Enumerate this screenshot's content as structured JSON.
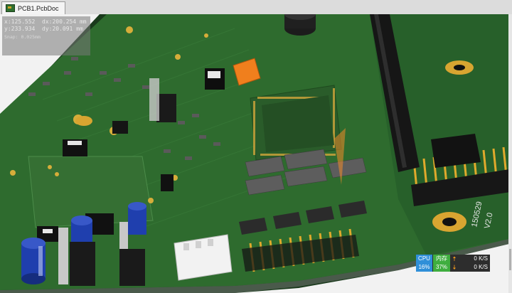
{
  "tab": {
    "title": "PCB1.PcbDoc",
    "icon": "pcb-document-icon"
  },
  "hud": {
    "x": "x:125.552",
    "dx": "dx:200.254 mm",
    "y": "y:233.934",
    "dy": "dy:20.091  mm",
    "snap": "Snap: 0.025mm"
  },
  "board": {
    "silkscreen_1": "150529",
    "silkscreen_2": "V2.0",
    "colors": {
      "board": "#2e6b2e",
      "board_dark": "#1f4f22",
      "pad": "#e0b43c",
      "chip": "#2a2a2a",
      "bg": "#f2f2f2"
    }
  },
  "perf": {
    "cpu_label": "CPU",
    "cpu_value": "16%",
    "mem_label": "内存",
    "mem_value": "37%",
    "upload_icon": "arrow-up-icon",
    "download_icon": "arrow-down-icon",
    "upload_value": "0 K/S",
    "download_value": "0 K/S"
  }
}
